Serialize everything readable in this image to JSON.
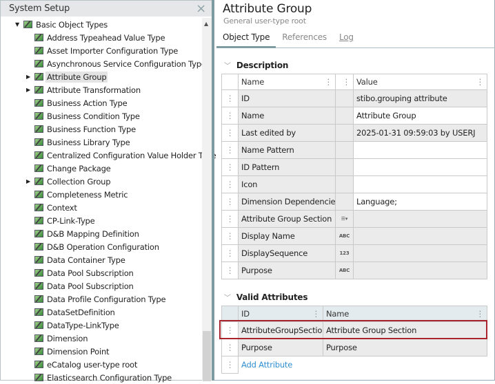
{
  "left_panel": {
    "title": "System Setup",
    "close_icon": "×",
    "tree": [
      {
        "label": "Basic Object Types",
        "level": 0,
        "arrow": "▼",
        "selected": false
      },
      {
        "label": "Address Typeahead Value Type",
        "level": 1,
        "arrow": "",
        "selected": false
      },
      {
        "label": "Asset Importer Configuration Type",
        "level": 1,
        "arrow": "",
        "selected": false
      },
      {
        "label": "Asynchronous Service Configuration Type",
        "level": 1,
        "arrow": "",
        "selected": false
      },
      {
        "label": "Attribute Group",
        "level": 1,
        "arrow": "▶",
        "selected": true
      },
      {
        "label": "Attribute Transformation",
        "level": 1,
        "arrow": "▶",
        "selected": false
      },
      {
        "label": "Business Action Type",
        "level": 1,
        "arrow": "",
        "selected": false
      },
      {
        "label": "Business Condition Type",
        "level": 1,
        "arrow": "",
        "selected": false
      },
      {
        "label": "Business Function Type",
        "level": 1,
        "arrow": "",
        "selected": false
      },
      {
        "label": "Business Library Type",
        "level": 1,
        "arrow": "",
        "selected": false
      },
      {
        "label": "Centralized Configuration Value Holder Type",
        "level": 1,
        "arrow": "",
        "selected": false
      },
      {
        "label": "Change Package",
        "level": 1,
        "arrow": "",
        "selected": false
      },
      {
        "label": "Collection Group",
        "level": 1,
        "arrow": "▶",
        "selected": false
      },
      {
        "label": "Completeness Metric",
        "level": 1,
        "arrow": "",
        "selected": false
      },
      {
        "label": "Context",
        "level": 1,
        "arrow": "",
        "selected": false
      },
      {
        "label": "CP-Link-Type",
        "level": 1,
        "arrow": "",
        "selected": false
      },
      {
        "label": "D&B Mapping Definition",
        "level": 1,
        "arrow": "",
        "selected": false
      },
      {
        "label": "D&B Operation Configuration",
        "level": 1,
        "arrow": "",
        "selected": false
      },
      {
        "label": "Data Container Type",
        "level": 1,
        "arrow": "",
        "selected": false
      },
      {
        "label": "Data Pool Subscription",
        "level": 1,
        "arrow": "",
        "selected": false
      },
      {
        "label": "Data Pool Subscription",
        "level": 1,
        "arrow": "",
        "selected": false
      },
      {
        "label": "Data Profile Configuration Type",
        "level": 1,
        "arrow": "",
        "selected": false
      },
      {
        "label": "DataSetDefinition",
        "level": 1,
        "arrow": "",
        "selected": false
      },
      {
        "label": "DataType-LinkType",
        "level": 1,
        "arrow": "",
        "selected": false
      },
      {
        "label": "Dimension",
        "level": 1,
        "arrow": "",
        "selected": false
      },
      {
        "label": "Dimension Point",
        "level": 1,
        "arrow": "",
        "selected": false
      },
      {
        "label": "eCatalog user-type root",
        "level": 1,
        "arrow": "",
        "selected": false
      },
      {
        "label": "Elasticsearch Configuration Type",
        "level": 1,
        "arrow": "",
        "selected": false
      }
    ]
  },
  "right_panel": {
    "title": "Attribute Group",
    "subtitle": "General user-type root",
    "tabs": [
      {
        "label": "Object Type",
        "active": true
      },
      {
        "label": "References",
        "active": false
      },
      {
        "label": "Log",
        "active": false
      }
    ],
    "description": {
      "heading": "Description",
      "columns": {
        "name": "Name",
        "value": "Value"
      },
      "rows": [
        {
          "name": "ID",
          "type_icon": "",
          "value": "stibo.grouping attribute",
          "editable": false
        },
        {
          "name": "Name",
          "type_icon": "",
          "value": "Attribute Group",
          "editable": true
        },
        {
          "name": "Last edited by",
          "type_icon": "",
          "value": "2025-01-31 09:59:03 by USERJ",
          "editable": false
        },
        {
          "name": "Name Pattern",
          "type_icon": "",
          "value": "",
          "editable": true
        },
        {
          "name": "ID Pattern",
          "type_icon": "",
          "value": "",
          "editable": true
        },
        {
          "name": "Icon",
          "type_icon": "",
          "value": "",
          "editable": true
        },
        {
          "name": "Dimension Dependencies",
          "type_icon": "",
          "value": "Language;",
          "editable": true
        },
        {
          "name": "Attribute Group Section",
          "type_icon": "☰▾",
          "value": "",
          "editable": false
        },
        {
          "name": "Display Name",
          "type_icon": "ABC",
          "value": "",
          "editable": false
        },
        {
          "name": "DisplaySequence",
          "type_icon": "123",
          "value": "",
          "editable": false
        },
        {
          "name": "Purpose",
          "type_icon": "ABC",
          "value": "",
          "editable": false
        }
      ]
    },
    "valid_attributes": {
      "heading": "Valid Attributes",
      "columns": {
        "id": "ID",
        "name": "Name"
      },
      "rows": [
        {
          "id": "AttributeGroupSection",
          "name": "Attribute Group Section",
          "highlighted": true
        },
        {
          "id": "Purpose",
          "name": "Purpose",
          "highlighted": false
        }
      ],
      "add_label": "Add Attribute"
    },
    "menu_dots": "⋮"
  }
}
